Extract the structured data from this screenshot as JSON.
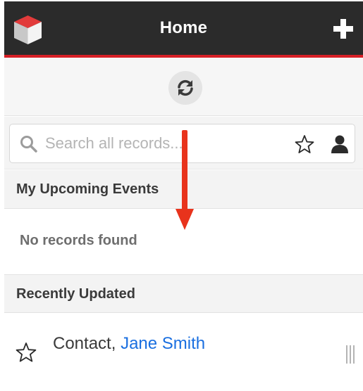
{
  "header": {
    "title": "Home",
    "logo_icon": "cube-logo-icon",
    "add_icon": "plus-icon"
  },
  "refresh": {
    "icon": "refresh-icon"
  },
  "search": {
    "placeholder": "Search all records...",
    "value": "",
    "star_icon": "star-icon",
    "person_icon": "person-icon"
  },
  "sections": {
    "upcoming": {
      "title": "My Upcoming Events",
      "empty_message": "No records found"
    },
    "recent": {
      "title": "Recently Updated",
      "items": [
        {
          "module": "Contact,",
          "name": "Jane Smith"
        }
      ]
    }
  },
  "colors": {
    "header_bg": "#2b2b2b",
    "header_accent": "#d61f26",
    "link": "#1a6fe0",
    "annotation_arrow": "#e8331c"
  }
}
